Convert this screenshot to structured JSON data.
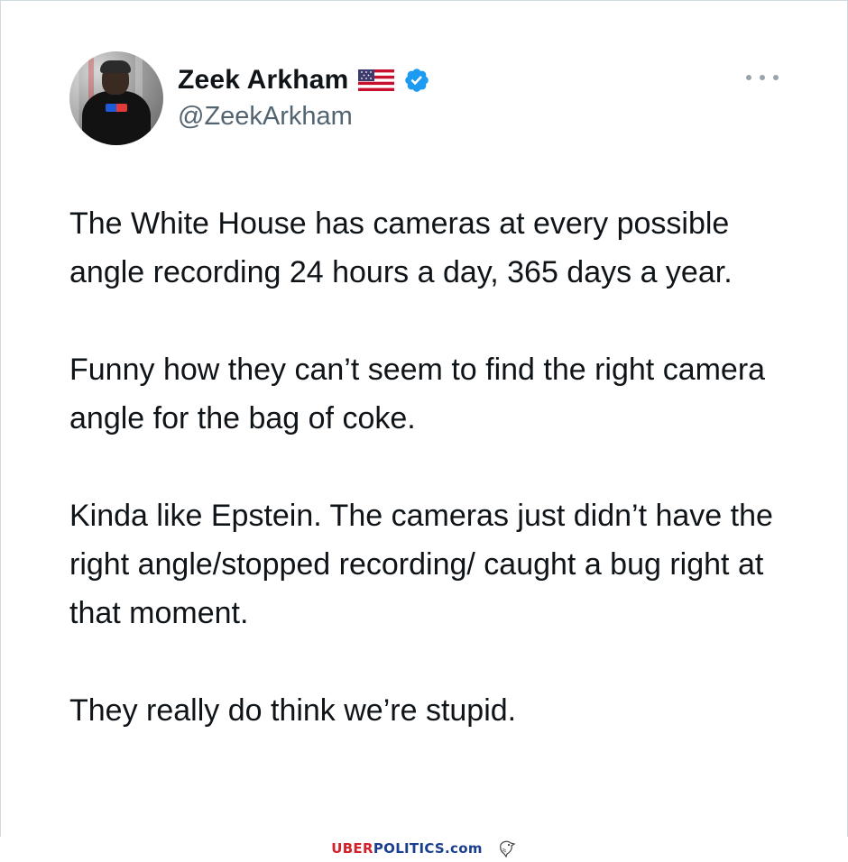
{
  "tweet": {
    "author": {
      "display_name": "Zeek Arkham",
      "handle": "@ZeekArkham",
      "flag_icon": "us-flag-icon",
      "verified_icon": "verified-badge-icon",
      "verified_color": "#1d9bf0"
    },
    "more_icon": "more-options-icon",
    "paragraphs": [
      "The White House has cameras at every possible angle recording 24 hours a day, 365 days a year.",
      "Funny how they can’t seem to find the right camera angle for the bag of coke.",
      "Kinda like Epstein. The cameras just didn’t have the right angle/stopped recording/ caught a bug right at that moment.",
      "They really do think we’re stupid."
    ]
  },
  "footer": {
    "brand_part1": "UBER",
    "brand_part2": "POLITICS.com",
    "brand_color_1": "#d4202a",
    "brand_color_2": "#1b3f8f",
    "mascot_icon": "eagle-icon"
  }
}
